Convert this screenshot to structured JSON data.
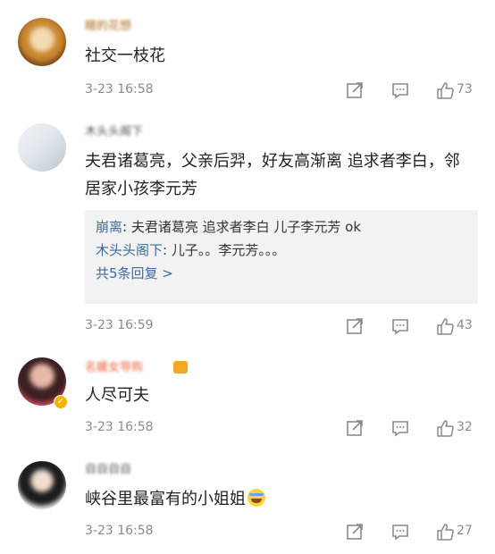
{
  "comments": [
    {
      "username": "瞎的花想",
      "text": "社交一枝花",
      "time": "3-23 16:58",
      "likes": "73"
    },
    {
      "username": "木头头阁下",
      "text": "夫君诸葛亮，父亲后羿，好友高渐离 追求者李白，邻居家小孩李元芳",
      "time": "3-23 16:59",
      "likes": "43",
      "replies": [
        {
          "name": "崩离",
          "text": "夫君诸葛亮 追求者李白 儿子李元芳 ok"
        },
        {
          "name": "木头头阁下",
          "text": "儿子。。李元芳。。。"
        }
      ],
      "more_replies": "共5条回复 >"
    },
    {
      "username": "名媛女导购",
      "text": "人尽可夫",
      "time": "3-23 16:58",
      "likes": "32"
    },
    {
      "username": "自自自自",
      "text": "峡谷里最富有的小姐姐",
      "time": "3-23 16:58",
      "likes": "27"
    }
  ],
  "icons": {
    "share": "share-icon",
    "reply": "comment-icon",
    "like": "thumbs-up-icon"
  },
  "colors": {
    "link_blue": "#3d6b9b",
    "meta_gray": "#8a8a8a",
    "reply_bg": "#f2f2f2"
  }
}
